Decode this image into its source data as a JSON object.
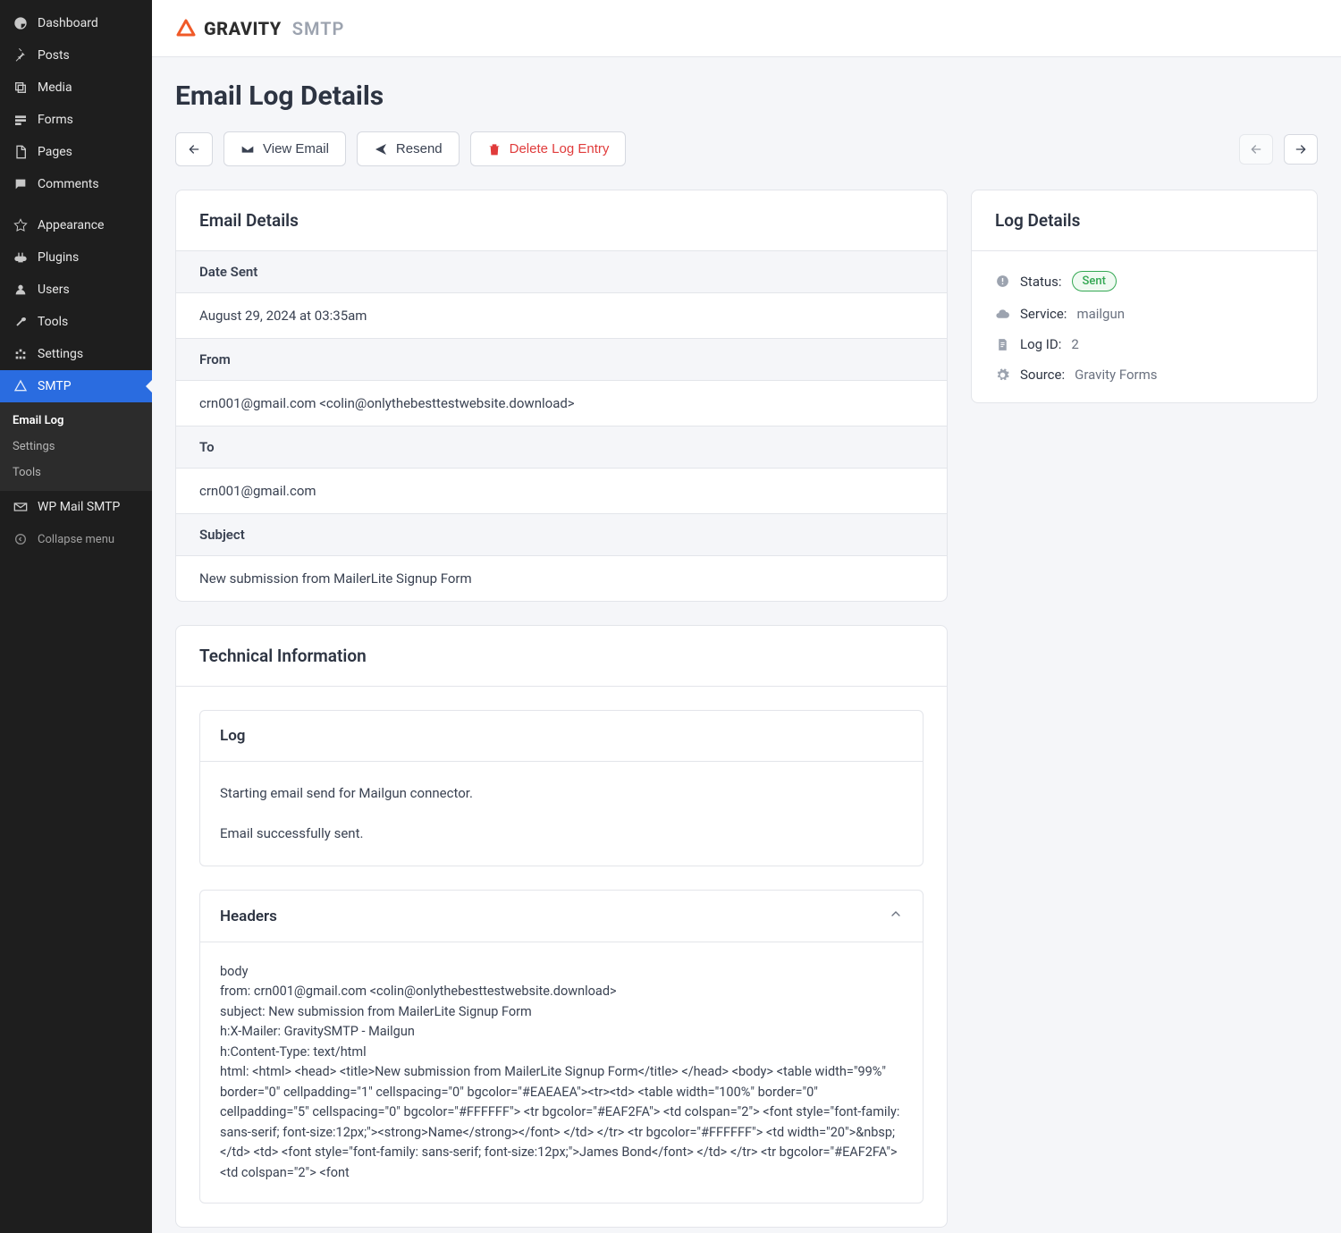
{
  "sidebar": {
    "items": [
      {
        "label": "Dashboard",
        "icon": "dashboard"
      },
      {
        "label": "Posts",
        "icon": "pin"
      },
      {
        "label": "Media",
        "icon": "media"
      },
      {
        "label": "Forms",
        "icon": "forms"
      },
      {
        "label": "Pages",
        "icon": "pages"
      },
      {
        "label": "Comments",
        "icon": "comments"
      },
      {
        "label": "Appearance",
        "icon": "appearance"
      },
      {
        "label": "Plugins",
        "icon": "plugins"
      },
      {
        "label": "Users",
        "icon": "users"
      },
      {
        "label": "Tools",
        "icon": "tools"
      },
      {
        "label": "Settings",
        "icon": "settings"
      },
      {
        "label": "SMTP",
        "icon": "smtp",
        "active": true
      },
      {
        "label": "WP Mail SMTP",
        "icon": "mail"
      }
    ],
    "smtp_sub": [
      {
        "label": "Email Log",
        "active": true
      },
      {
        "label": "Settings"
      },
      {
        "label": "Tools"
      }
    ],
    "collapse_label": "Collapse menu"
  },
  "brand": {
    "text": "GRAVITY",
    "sub": "SMTP"
  },
  "page": {
    "title": "Email Log Details"
  },
  "toolbar": {
    "back_label": "",
    "view_email_label": "View Email",
    "resend_label": "Resend",
    "delete_label": "Delete Log Entry"
  },
  "email_details": {
    "title": "Email Details",
    "date_sent_label": "Date Sent",
    "date_sent_value": "August 29, 2024 at 03:35am",
    "from_label": "From",
    "from_value": "crn001@gmail.com <colin@onlythebesttestwebsite.download>",
    "to_label": "To",
    "to_value": "crn001@gmail.com",
    "subject_label": "Subject",
    "subject_value": "New submission from MailerLite Signup Form"
  },
  "technical": {
    "title": "Technical Information",
    "log_title": "Log",
    "log_lines": [
      "Starting email send for Mailgun connector.",
      "Email successfully sent."
    ],
    "headers_title": "Headers",
    "headers_body": "body\nfrom: crn001@gmail.com <colin@onlythebesttestwebsite.download>\nsubject: New submission from MailerLite Signup Form\nh:X-Mailer: GravitySMTP - Mailgun\nh:Content-Type: text/html\nhtml: <html> <head> <title>New submission from MailerLite Signup Form</title> </head> <body> <table width=\"99%\" border=\"0\" cellpadding=\"1\" cellspacing=\"0\" bgcolor=\"#EAEAEA\"><tr><td> <table width=\"100%\" border=\"0\" cellpadding=\"5\" cellspacing=\"0\" bgcolor=\"#FFFFFF\"> <tr bgcolor=\"#EAF2FA\"> <td colspan=\"2\"> <font style=\"font-family: sans-serif; font-size:12px;\"><strong>Name</strong></font> </td> </tr> <tr bgcolor=\"#FFFFFF\"> <td width=\"20\">&nbsp;</td> <td> <font style=\"font-family: sans-serif; font-size:12px;\">James Bond</font> </td> </tr> <tr bgcolor=\"#EAF2FA\"> <td colspan=\"2\"> <font"
  },
  "log_details": {
    "title": "Log Details",
    "status_label": "Status:",
    "status_value": "Sent",
    "service_label": "Service:",
    "service_value": "mailgun",
    "logid_label": "Log ID:",
    "logid_value": "2",
    "source_label": "Source:",
    "source_value": "Gravity Forms"
  }
}
